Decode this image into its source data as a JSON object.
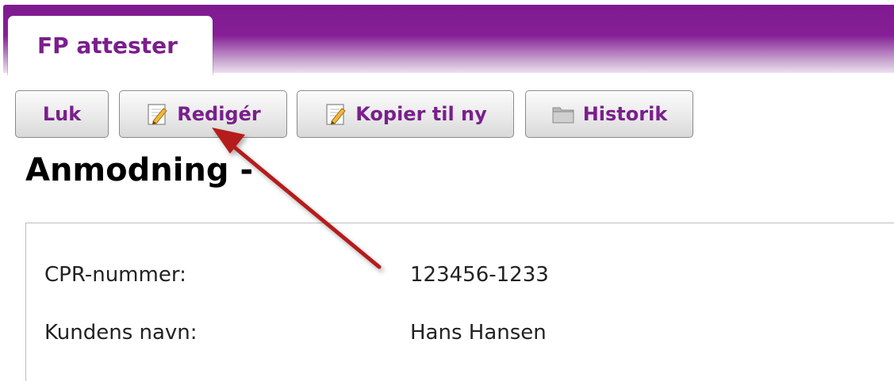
{
  "tab": {
    "label": "FP attester"
  },
  "toolbar": {
    "close_label": "Luk",
    "edit_label": "Redigér",
    "copy_label": "Kopier til ny",
    "history_label": "Historik"
  },
  "heading": "Anmodning -",
  "fields": [
    {
      "label": "CPR-nummer:",
      "value": "123456-1233"
    },
    {
      "label": "Kundens navn:",
      "value": "Hans Hansen"
    }
  ],
  "colors": {
    "brand_purple": "#7e1a8f",
    "arrow_red": "#b51c1c"
  }
}
